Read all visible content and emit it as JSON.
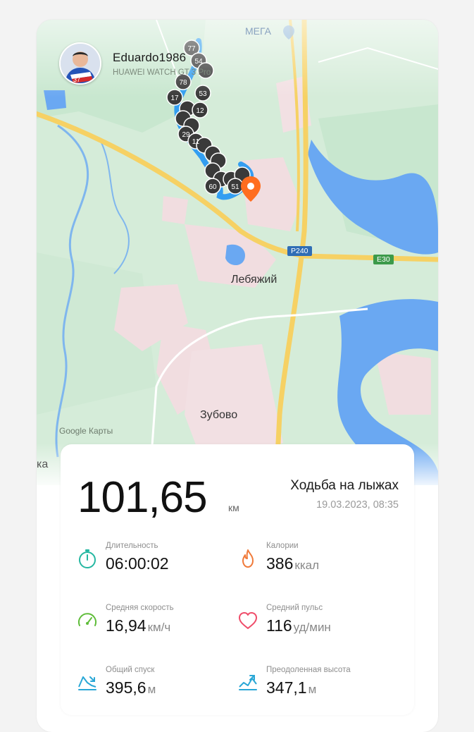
{
  "user": {
    "name": "Eduardo1986",
    "device": "HUAWEI WATCH GT 3 Pro",
    "avatar_badge": "37"
  },
  "map": {
    "labels": {
      "mega": "МЕГА",
      "lebyazhiy": "Лебяжий",
      "zubovo": "Зубово",
      "cut_label": "ка",
      "google": "Google Карты"
    },
    "roads": {
      "r240": "Р240",
      "e30": "E30"
    },
    "route_markers": [
      "77",
      "54",
      "78",
      "53",
      "17",
      "12",
      "29",
      "11",
      "60",
      "51"
    ],
    "colors": {
      "land": "#d9eedd",
      "park": "#c4e6cc",
      "water": "#6aa8f2",
      "urban": "#f2dde0",
      "highway": "#f6d164",
      "route": "#2196f3",
      "marker": "#3a3a3a",
      "end_pin": "#ff6d1f"
    }
  },
  "workout": {
    "distance": "101,65",
    "distance_unit": "км",
    "activity": "Ходьба на лыжах",
    "datetime": "19.03.2023, 08:35"
  },
  "metrics": {
    "duration": {
      "label": "Длительность",
      "value": "06:00:02",
      "unit": "",
      "icon": "stopwatch-icon",
      "color": "#25b7a1"
    },
    "calories": {
      "label": "Калории",
      "value": "386",
      "unit": "ккал",
      "icon": "flame-icon",
      "color": "#f07a3a"
    },
    "avg_speed": {
      "label": "Средняя скорость",
      "value": "16,94",
      "unit": "км/ч",
      "icon": "speedometer-icon",
      "color": "#5fbd3a"
    },
    "avg_hr": {
      "label": "Средний пульс",
      "value": "116",
      "unit": "уд/мин",
      "icon": "heart-icon",
      "color": "#ef4d6a"
    },
    "descent": {
      "label": "Общий спуск",
      "value": "395,6",
      "unit": "м",
      "icon": "descent-icon",
      "color": "#2aa7d6"
    },
    "ascent": {
      "label": "Преодоленная высота",
      "value": "347,1",
      "unit": "м",
      "icon": "ascent-icon",
      "color": "#2aa7d6"
    }
  }
}
